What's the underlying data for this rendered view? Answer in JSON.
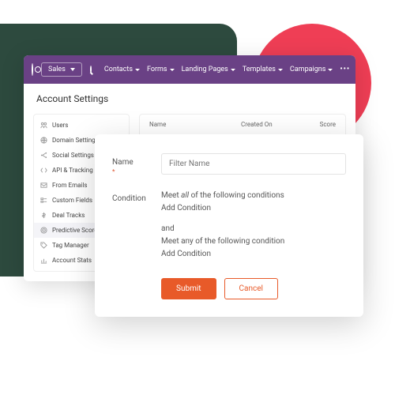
{
  "header": {
    "dropdown_label": "Sales",
    "nav": [
      "Contacts",
      "Forms",
      "Landing Pages",
      "Templates",
      "Campaigns"
    ],
    "more": "•••"
  },
  "page": {
    "title": "Account Settings"
  },
  "sidebar": {
    "items": [
      {
        "label": "Users",
        "icon": "users-icon"
      },
      {
        "label": "Domain Settings",
        "icon": "globe-icon"
      },
      {
        "label": "Social Settings",
        "icon": "share-icon"
      },
      {
        "label": "API & Tracking Code",
        "icon": "code-icon"
      },
      {
        "label": "From Emails",
        "icon": "mail-icon"
      },
      {
        "label": "Custom Fields",
        "icon": "fields-icon"
      },
      {
        "label": "Deal Tracks",
        "icon": "deal-icon"
      },
      {
        "label": "Predictive Score",
        "icon": "target-icon"
      },
      {
        "label": "Tag Manager",
        "icon": "tag-icon"
      },
      {
        "label": "Account Stats",
        "icon": "stats-icon"
      }
    ],
    "active_index": 7
  },
  "table": {
    "columns": {
      "name": "Name",
      "created": "Created On",
      "score": "Score"
    }
  },
  "modal": {
    "name_label": "Name",
    "required_mark": "*",
    "name_placeholder": "Filter Name",
    "condition_label": "Condition",
    "cond_line1_pre": "Meet ",
    "cond_line1_em": "all",
    "cond_line1_post": " of the following conditions",
    "add_condition": "Add Condition",
    "and": "and",
    "cond_line2": "Meet any of the following condition",
    "submit": "Submit",
    "cancel": "Cancel"
  },
  "colors": {
    "brand": "#6a4185",
    "accent": "#e85a29"
  }
}
